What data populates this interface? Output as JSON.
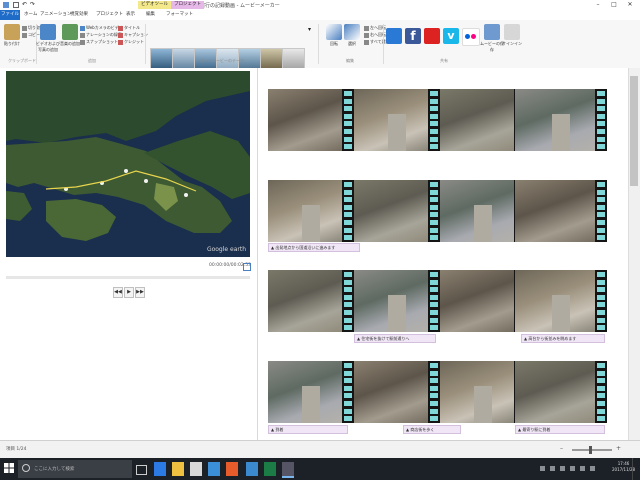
{
  "window": {
    "title": "旅行の記録動画 - ムービーメーカー",
    "contextual_tabs": [
      "ビデオツール",
      "プロジェクト"
    ],
    "controls": [
      "–",
      "□",
      "✕"
    ]
  },
  "ribbon": {
    "file_tab": "ファイル",
    "tabs": [
      "ホーム",
      "アニメーション",
      "視覚効果",
      "プロジェクト",
      "表示",
      "編集",
      "フォーマット"
    ],
    "groups": [
      "クリップボード",
      "追加",
      "オートムービーのテーマ",
      "編集",
      "共有"
    ],
    "clipboard": [
      "貼り付け",
      "切り取り",
      "コピー"
    ],
    "add_big": [
      "ビデオおよび写真の追加",
      "音楽の追加"
    ],
    "add_small": [
      "Webカメラのビデオ",
      "ナレーションの録音",
      "スナップショット"
    ],
    "add_right": [
      "タイトル",
      "キャプション",
      "クレジット"
    ],
    "edit_big": [
      "回転",
      "選択"
    ],
    "edit_small": [
      "左へ回転",
      "右へ回転",
      "すべて選択"
    ],
    "share_labels": [
      "ムービーの保存",
      "サインイン"
    ],
    "theme_count": 7,
    "share_icons": [
      "onedrive-icon",
      "facebook-icon",
      "youtube-icon",
      "vimeo-icon",
      "flickr-icon"
    ]
  },
  "preview": {
    "timecode": "00:00:00/00:02:53",
    "controls": [
      "◀◀",
      "▶",
      "▶▶"
    ],
    "map_watermark": "Google earth"
  },
  "storyboard": {
    "rows": [
      {
        "caption": "",
        "caption2": ""
      },
      {
        "caption": "▲ 出発地点から国道沿いに進みます",
        "caption2": ""
      },
      {
        "caption": "▲ 住宅街を抜けて駅前通りへ",
        "caption2": "▲ 高台から街並みを眺めます"
      },
      {
        "caption": "▲ 到着",
        "caption2": "▲ 商店街を歩く",
        "caption3": "▲ 最寄り駅に到着"
      }
    ]
  },
  "statusbar": {
    "text": "項目 1/24"
  },
  "taskbar": {
    "search_placeholder": "ここに入力して検索",
    "time": "17:46",
    "date": "2017/11/28"
  },
  "colors": {
    "accent": "#1e6cc8",
    "film_perforation": "#7fd7d7",
    "caption_bg": "#f0e6f6",
    "taskbar": "#1c2128"
  }
}
